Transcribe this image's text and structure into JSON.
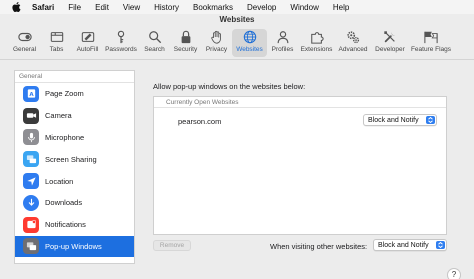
{
  "menubar": {
    "items": [
      "Safari",
      "File",
      "Edit",
      "View",
      "History",
      "Bookmarks",
      "Develop",
      "Window",
      "Help"
    ]
  },
  "window": {
    "title": "Websites"
  },
  "toolbar": {
    "items": [
      {
        "label": "General",
        "icon": "switch-icon"
      },
      {
        "label": "Tabs",
        "icon": "tabs-icon"
      },
      {
        "label": "AutoFill",
        "icon": "autofill-icon"
      },
      {
        "label": "Passwords",
        "icon": "key-icon"
      },
      {
        "label": "Search",
        "icon": "search-icon"
      },
      {
        "label": "Security",
        "icon": "lock-icon"
      },
      {
        "label": "Privacy",
        "icon": "hand-icon"
      },
      {
        "label": "Websites",
        "icon": "globe-icon",
        "active": true
      },
      {
        "label": "Profiles",
        "icon": "person-icon"
      },
      {
        "label": "Extensions",
        "icon": "puzzle-icon"
      },
      {
        "label": "Advanced",
        "icon": "gears-icon"
      },
      {
        "label": "Developer",
        "icon": "wrench-icon"
      },
      {
        "label": "Feature Flags",
        "icon": "flags-icon"
      }
    ]
  },
  "sidebar": {
    "header": "General",
    "items": [
      {
        "label": "Page Zoom",
        "icon": "page-zoom-icon",
        "color": "#2f7cf0"
      },
      {
        "label": "Camera",
        "icon": "camera-icon",
        "color": "#3b3b3b"
      },
      {
        "label": "Microphone",
        "icon": "microphone-icon",
        "color": "#8e8e93"
      },
      {
        "label": "Screen Sharing",
        "icon": "screen-sharing-icon",
        "color": "#3aa5f2"
      },
      {
        "label": "Location",
        "icon": "location-icon",
        "color": "#2f7cf0"
      },
      {
        "label": "Downloads",
        "icon": "downloads-icon",
        "color": "#2f7cf0"
      },
      {
        "label": "Notifications",
        "icon": "notifications-icon",
        "color": "#ff3b30"
      },
      {
        "label": "Pop-up Windows",
        "icon": "popup-windows-icon",
        "color": "#6e6e73",
        "active": true
      }
    ]
  },
  "main": {
    "description": "Allow pop-up windows on the websites below:",
    "table_header": "Currently Open Websites",
    "rows": [
      {
        "site": "pearson.com",
        "setting": "Block and Notify"
      }
    ],
    "remove_label": "Remove",
    "other_label": "When visiting other websites:",
    "other_setting": "Block and Notify"
  },
  "help_label": "?",
  "colors": {
    "accent": "#1d6fe0"
  }
}
